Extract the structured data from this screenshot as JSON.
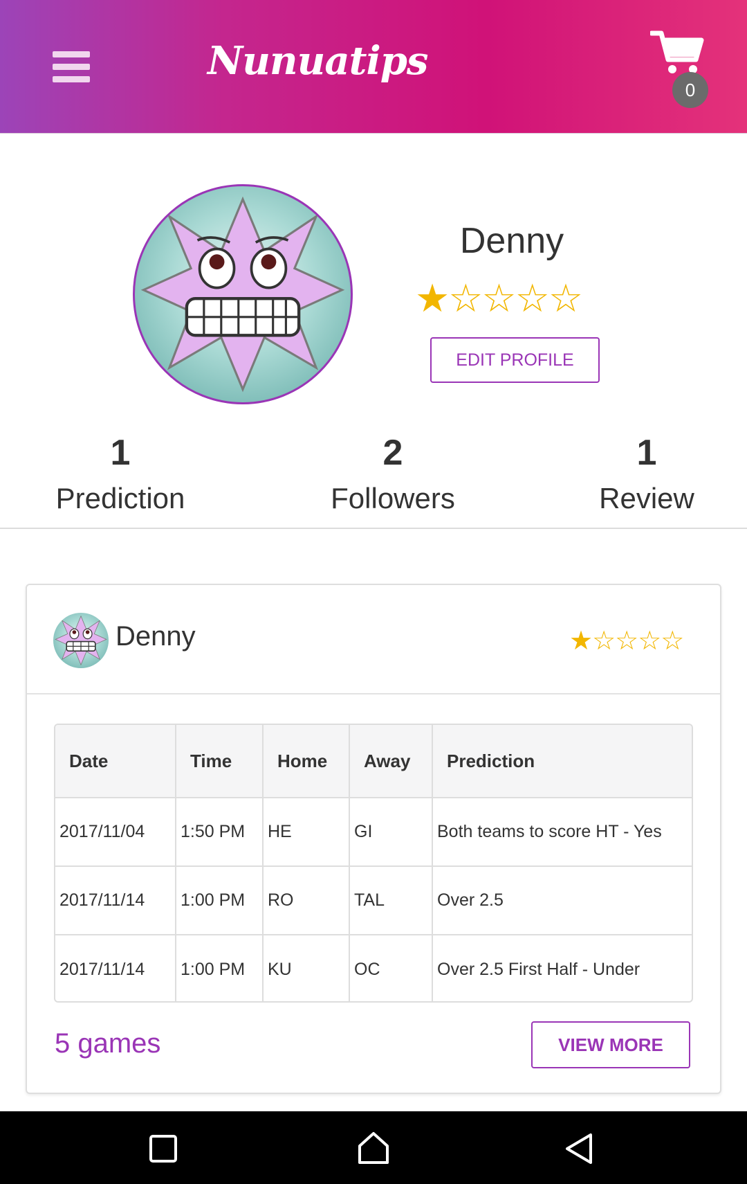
{
  "header": {
    "brand": "Nunuatips",
    "cart_count": "0",
    "icons": {
      "menu": "hamburger-menu-icon",
      "cart": "shopping-cart-icon"
    }
  },
  "profile": {
    "name": "Denny",
    "rating_stars": "★☆☆☆☆",
    "rating_value": 1,
    "rating_max": 5,
    "edit_label": "EDIT PROFILE"
  },
  "stats": [
    {
      "value": "1",
      "label": "Prediction"
    },
    {
      "value": "2",
      "label": "Followers"
    },
    {
      "value": "1",
      "label": "Review"
    }
  ],
  "card": {
    "user_name": "Denny",
    "rating_stars": "★☆☆☆☆",
    "table": {
      "headers": [
        "Date",
        "Time",
        "Home",
        "Away",
        "Prediction"
      ],
      "rows": [
        [
          "2017/11/04",
          "1:50 PM",
          "HE",
          "GI",
          "Both teams to score HT - Yes"
        ],
        [
          "2017/11/14",
          "1:00 PM",
          "RO",
          "TAL",
          "Over 2.5"
        ],
        [
          "2017/11/14",
          "1:00 PM",
          "KU",
          "OC",
          "Over 2.5 First Half - Under"
        ]
      ]
    },
    "games_count": "5 games",
    "view_more_label": "VIEW MORE"
  },
  "navbar": {
    "icons": [
      "recent-apps-icon",
      "home-icon",
      "back-icon"
    ]
  },
  "colors": {
    "accent": "#9a35b6",
    "star": "#f2b600",
    "header_start": "#9c44b8",
    "header_end": "#e4327a"
  }
}
